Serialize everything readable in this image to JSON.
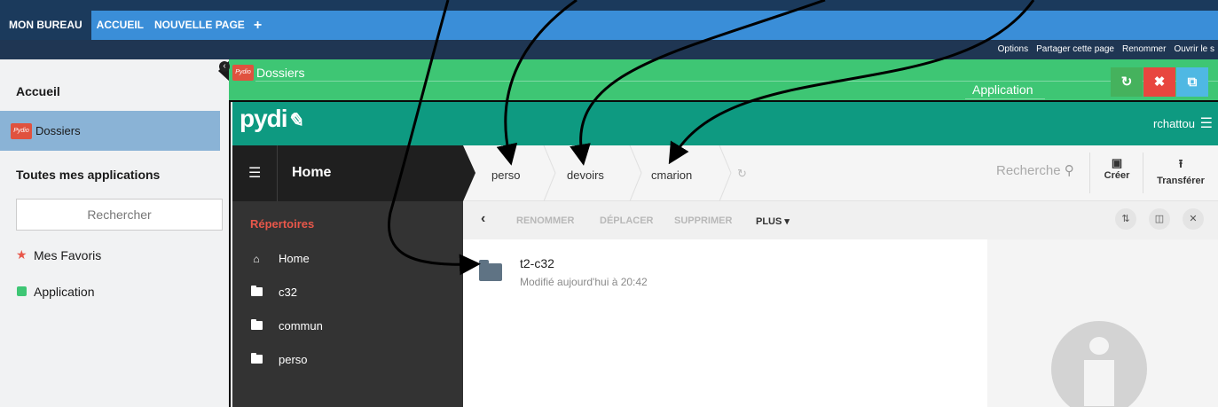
{
  "nav": {
    "my_desk": "MON BUREAU",
    "home": "ACCUEIL",
    "new_page": "NOUVELLE PAGE",
    "add_icon": "plus-icon"
  },
  "options": {
    "items": [
      "Options",
      "Partager cette page",
      "Renommer",
      "Ouvrir le s"
    ]
  },
  "portal": {
    "heading_home": "Accueil",
    "selected_app": "Dossiers",
    "heading_apps": "Toutes mes applications",
    "search_placeholder": "Rechercher",
    "favorites": "Mes Favoris",
    "application": "Application"
  },
  "appbar": {
    "title": "Dossiers",
    "subtitle": "Application"
  },
  "pydio": {
    "logo": "pydi",
    "logo_icon": "pen-icon",
    "logo_mini": "Pydio",
    "user": "rchattou",
    "home_title": "Home",
    "repositories_label": "Répertoires",
    "nav_items": [
      "Home",
      "c32",
      "commun",
      "perso"
    ],
    "breadcrumb": [
      "perso",
      "devoirs",
      "cmarion"
    ],
    "search_placeholder": "Recherche",
    "create_label": "Créer",
    "transfer_label": "Transférer",
    "actions": {
      "rename": "RENOMMER",
      "move": "DÉPLACER",
      "delete": "SUPPRIMER",
      "more": "PLUS"
    },
    "file": {
      "name": "t2-c32",
      "modified": "Modifié aujourd'hui à 20:42"
    }
  },
  "colors": {
    "nav_blue": "#3a8ed8",
    "app_green": "#3ec674",
    "pydio_teal": "#0e9a81",
    "sidebar_dark": "#333333",
    "accent_red": "#e8574a"
  }
}
